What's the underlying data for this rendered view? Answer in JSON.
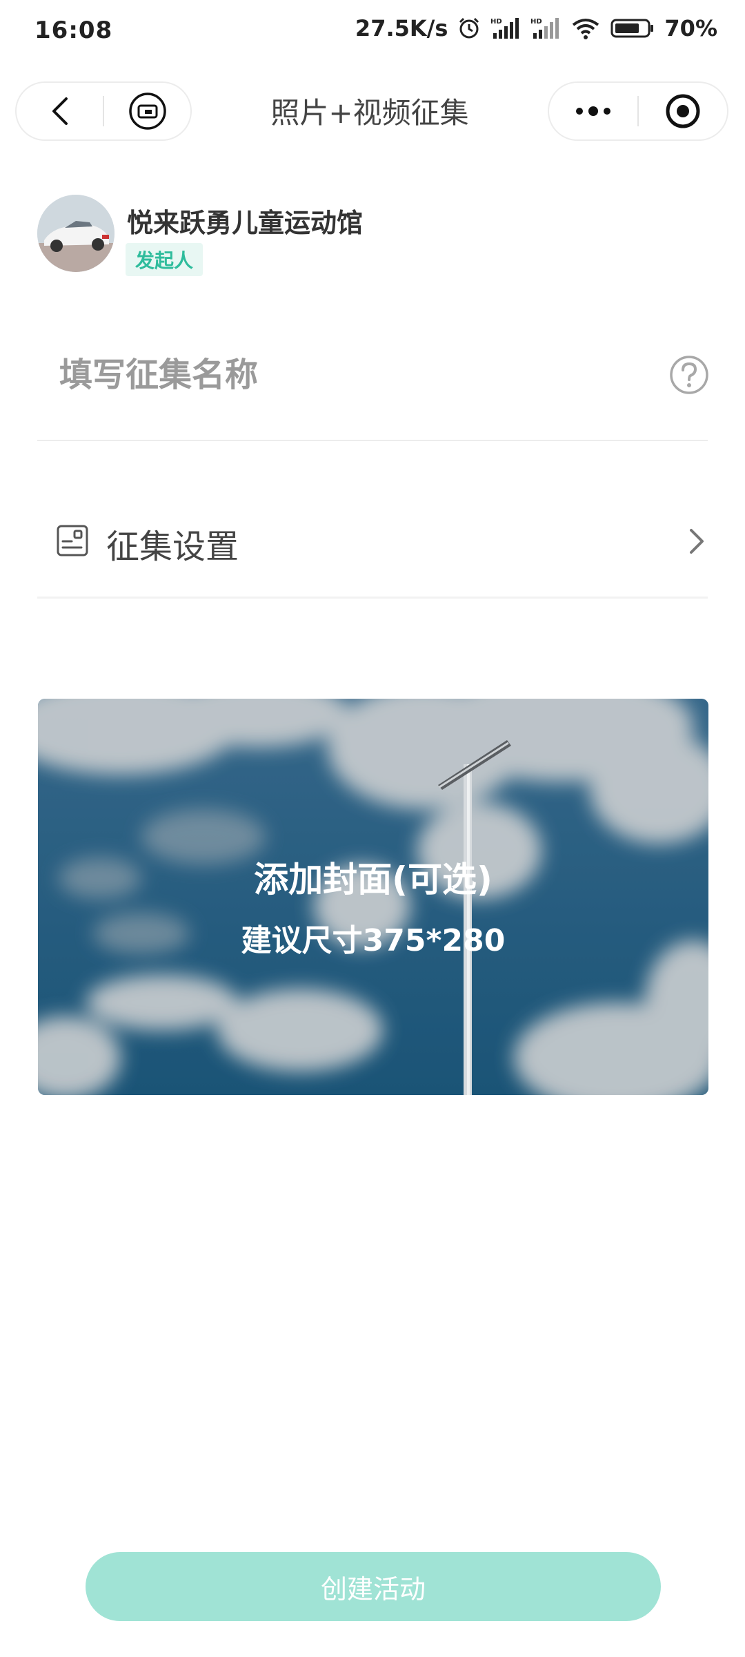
{
  "status_bar": {
    "time": "16:08",
    "net_speed": "27.5K/s",
    "battery": "70%"
  },
  "nav": {
    "title": "照片+视频征集"
  },
  "initiator": {
    "name": "悦来跃勇儿童运动馆",
    "role": "发起人"
  },
  "form": {
    "name_placeholder": "填写征集名称",
    "name_value": ""
  },
  "settings": {
    "label": "征集设置"
  },
  "cover": {
    "title": "添加封面(可选)",
    "subtitle": "建议尺寸375*280"
  },
  "footer": {
    "create_label": "创建活动"
  },
  "colors": {
    "accent": "#2ebc9c",
    "button_disabled": "#a0e3d5"
  }
}
